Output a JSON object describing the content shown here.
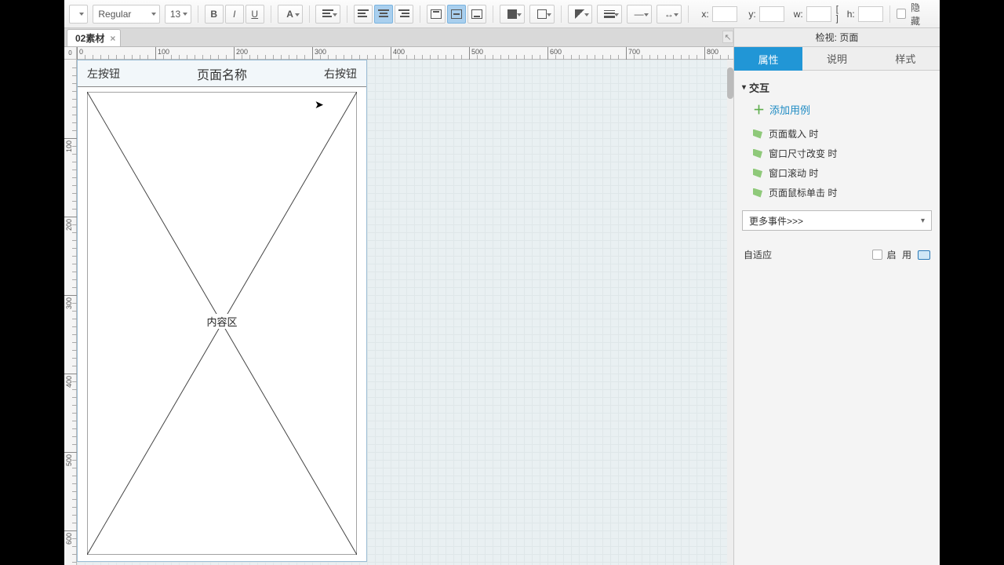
{
  "toolbar": {
    "font_weight": "Regular",
    "font_size": "13",
    "bold": "B",
    "italic": "I",
    "underline": "U",
    "coord_x_label": "x:",
    "coord_y_label": "y:",
    "coord_w_label": "w:",
    "coord_h_label": "h:",
    "corner_icon_label": "[ ]",
    "hide_label": "隐 藏"
  },
  "tabs": {
    "active": "02素材"
  },
  "ruler": {
    "origin": "0",
    "h": [
      "0",
      "100",
      "200",
      "300",
      "400",
      "500",
      "600",
      "700",
      "800"
    ],
    "v": [
      "100",
      "200",
      "300",
      "400",
      "500",
      "600"
    ]
  },
  "page_mock": {
    "left_button": "左按钮",
    "title": "页面名称",
    "right_button": "右按钮",
    "content_label": "内容区"
  },
  "inspector": {
    "title": "检视: 页面",
    "tabs": {
      "props": "属性",
      "notes": "说明",
      "style": "样式"
    },
    "section_interaction": "交互",
    "add_case": "添加用例",
    "events": [
      "页面载入 时",
      "窗口尺寸改变 时",
      "窗口滚动 时",
      "页面鼠标单击 时"
    ],
    "more_events": "更多事件>>>",
    "adaptive_label": "自适应",
    "enable_label": "启 用"
  }
}
